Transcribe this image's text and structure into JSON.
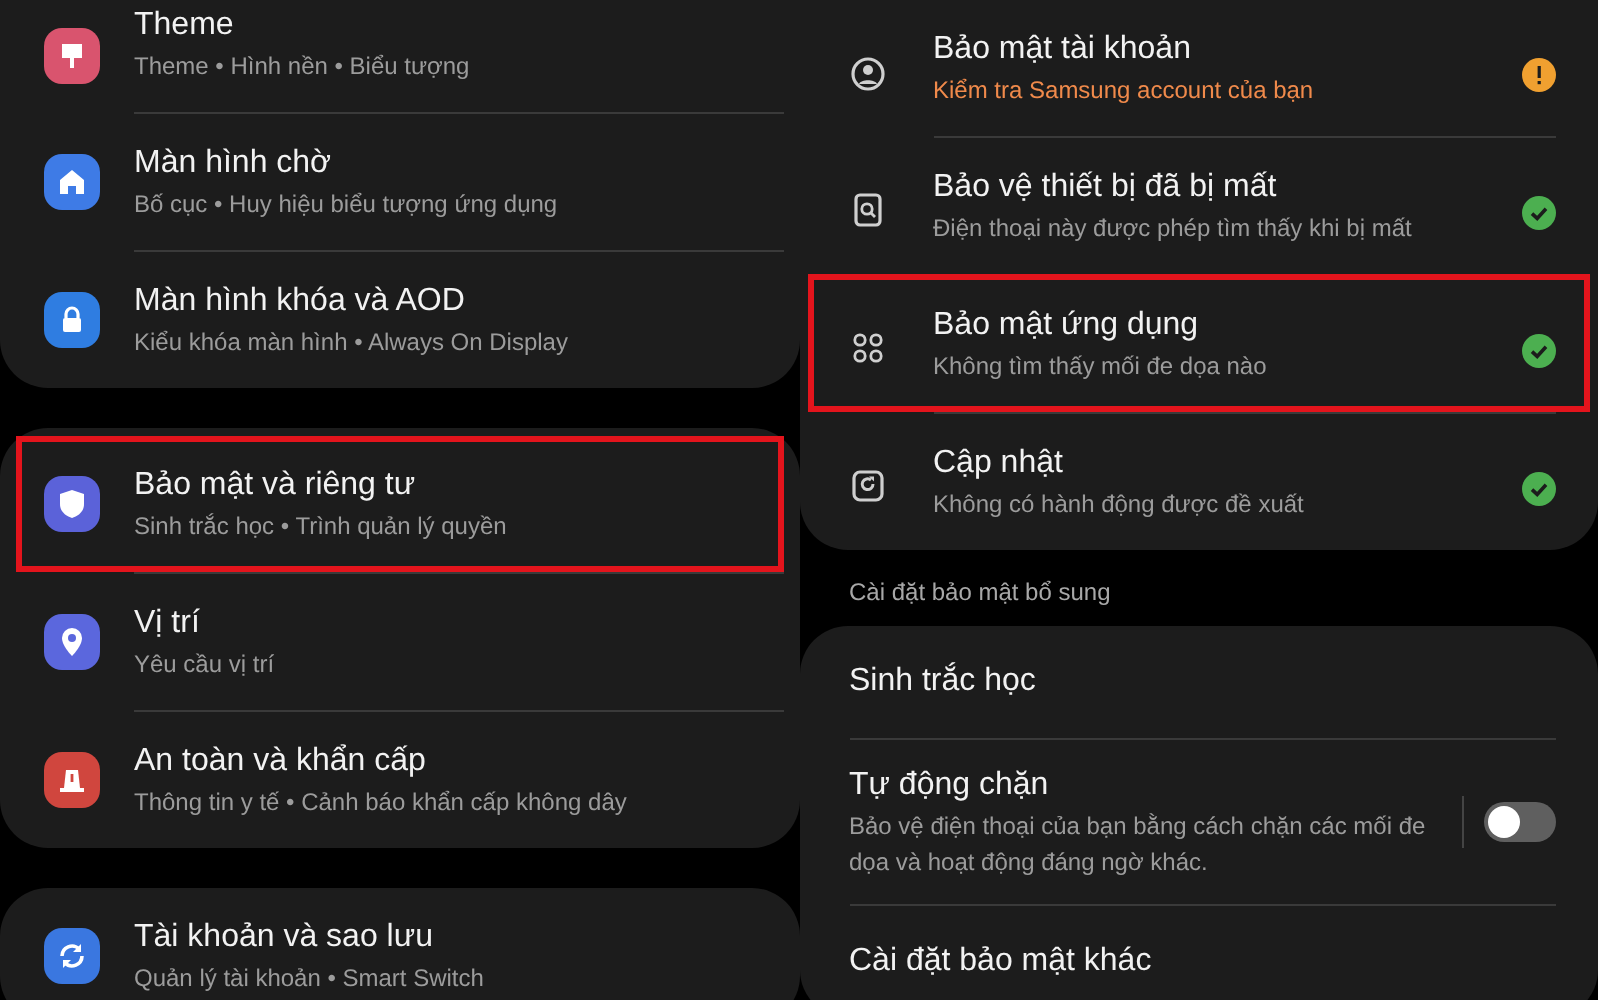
{
  "left_panel": {
    "groups": [
      {
        "items": [
          {
            "title": "Theme",
            "subtitle": "Theme • Hình nền • Biểu tượng",
            "highlighted": false
          },
          {
            "title": "Màn hình chờ",
            "subtitle": "Bố cục • Huy hiệu biểu tượng ứng dụng",
            "highlighted": false
          },
          {
            "title": "Màn hình khóa và AOD",
            "subtitle": "Kiểu khóa màn hình • Always On Display",
            "highlighted": false
          }
        ]
      },
      {
        "items": [
          {
            "title": "Bảo mật và riêng tư",
            "subtitle": "Sinh trắc học • Trình quản lý quyền",
            "highlighted": true
          },
          {
            "title": "Vị trí",
            "subtitle": "Yêu cầu vị trí",
            "highlighted": false
          },
          {
            "title": "An toàn và khẩn cấp",
            "subtitle": "Thông tin y tế • Cảnh báo khẩn cấp không dây",
            "highlighted": false
          }
        ]
      },
      {
        "items": [
          {
            "title": "Tài khoản và sao lưu",
            "subtitle": "Quản lý tài khoản • Smart Switch",
            "highlighted": false
          }
        ]
      }
    ]
  },
  "right_panel": {
    "status_items": [
      {
        "title": "Bảo mật tài khoản",
        "subtitle": "Kiểm tra Samsung account của bạn",
        "warning": true,
        "highlighted": false
      },
      {
        "title": "Bảo vệ thiết bị đã bị mất",
        "subtitle": "Điện thoại này được phép tìm thấy khi bị mất",
        "warning": false,
        "highlighted": false
      },
      {
        "title": "Bảo mật ứng dụng",
        "subtitle": "Không tìm thấy mối đe dọa nào",
        "warning": false,
        "highlighted": true
      },
      {
        "title": "Cập nhật",
        "subtitle": "Không có hành động được đề xuất",
        "warning": false,
        "highlighted": false
      }
    ],
    "section_heading": "Cài đặt bảo mật bổ sung",
    "extra_items": [
      {
        "kind": "link",
        "title": "Sinh trắc học"
      },
      {
        "kind": "toggle",
        "title": "Tự động chặn",
        "subtitle": "Bảo vệ điện thoại của bạn bằng cách chặn các mối đe dọa và hoạt động đáng ngờ khác.",
        "on": false
      },
      {
        "kind": "link",
        "title": "Cài đặt bảo mật khác"
      }
    ]
  }
}
